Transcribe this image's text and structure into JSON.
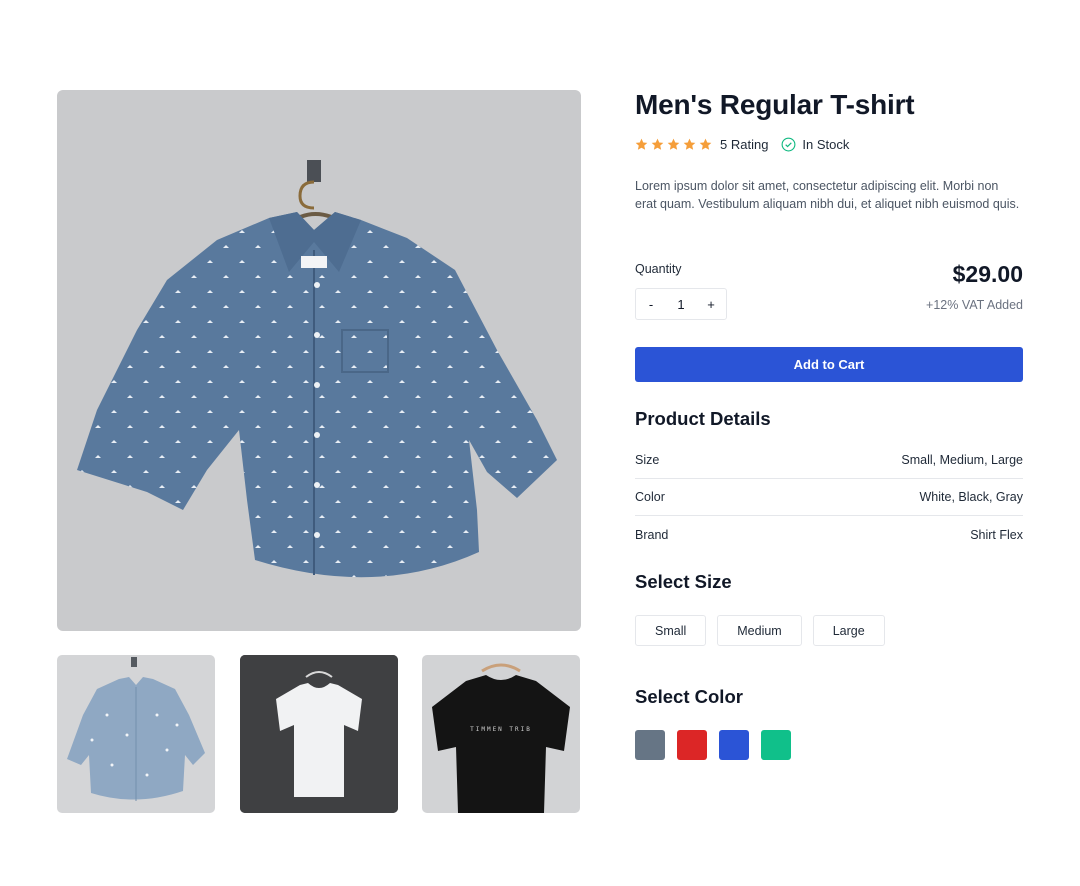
{
  "product": {
    "title": "Men's Regular T-shirt",
    "rating_text": "5 Rating",
    "rating_value": 5,
    "rating_max": 5,
    "stock_text": "In Stock",
    "description": "Lorem ipsum dolor sit amet, consectetur adipiscing elit. Morbi non erat quam. Vestibulum aliquam nibh dui, et aliquet nibh euismod quis."
  },
  "purchase": {
    "quantity_label": "Quantity",
    "decrement": "-",
    "quantity": "1",
    "increment": "+",
    "price": "$29.00",
    "vat_note": "+12% VAT Added",
    "add_to_cart": "Add to Cart"
  },
  "details": {
    "title": "Product Details",
    "rows": [
      {
        "label": "Size",
        "value": "Small, Medium, Large"
      },
      {
        "label": "Color",
        "value": "White, Black, Gray"
      },
      {
        "label": "Brand",
        "value": "Shirt Flex"
      }
    ]
  },
  "size_select": {
    "title": "Select Size",
    "options": [
      "Small",
      "Medium",
      "Large"
    ]
  },
  "color_select": {
    "title": "Select Color",
    "swatches": [
      "#667585",
      "#dc2626",
      "#2b54d6",
      "#10c08a"
    ]
  },
  "gallery": {
    "thumbnails": [
      "denim-polka-dot-shirt",
      "white-t-shirt",
      "black-t-shirt"
    ],
    "thumb3_print": "TIMMEN TRIB"
  },
  "colors": {
    "accent": "#2b54d6",
    "star": "#f59e3a",
    "stock_check": "#10b981"
  }
}
